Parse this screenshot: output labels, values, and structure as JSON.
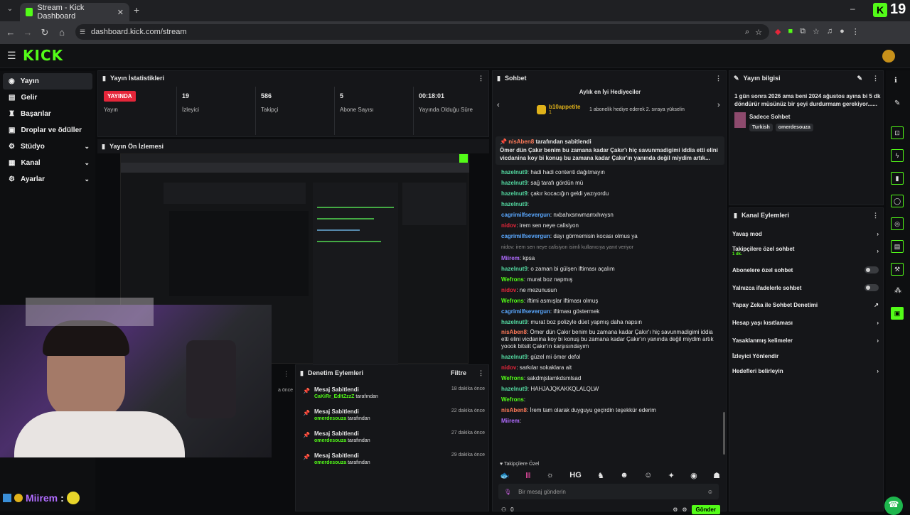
{
  "browser": {
    "tab_title": "Stream - Kick Dashboard",
    "url": "dashboard.kick.com/stream",
    "counter": "19"
  },
  "brand": {
    "logo": "KICK",
    "accent": "#53fc18"
  },
  "sidebar": {
    "items": [
      {
        "label": "Yayın"
      },
      {
        "label": "Gelir"
      },
      {
        "label": "Başarılar"
      },
      {
        "label": "Droplar ve ödüller"
      },
      {
        "label": "Stüdyo"
      },
      {
        "label": "Kanal"
      },
      {
        "label": "Ayarlar"
      }
    ]
  },
  "stats": {
    "title": "Yayın İstatistikleri",
    "live_badge": "YAYINDA",
    "live_label": "Yayın",
    "viewers_value": "19",
    "viewers_label": "İzleyici",
    "followers_value": "586",
    "followers_label": "Takipçi",
    "subs_value": "5",
    "subs_label": "Abone Sayısı",
    "duration_value": "00:18:01",
    "duration_label": "Yayında Olduğu Süre"
  },
  "preview": {
    "title": "Yayın Ön İzlemesi"
  },
  "mod_actions": {
    "title": "Denetim Eylemleri",
    "filter": "Filtre",
    "items": [
      {
        "action": "Mesaj Sabitlendi",
        "user": "CaKiRr_EdItZzzZ",
        "suffix": "tarafından",
        "time": "18 dakika önce"
      },
      {
        "action": "Mesaj Sabitlendi",
        "user": "omerdesouza",
        "suffix": "tarafından",
        "time": "22 dakika önce"
      },
      {
        "action": "Mesaj Sabitlendi",
        "user": "omerdesouza",
        "suffix": "tarafından",
        "time": "27 dakika önce"
      },
      {
        "action": "Mesaj Sabitlendi",
        "user": "omerdesouza",
        "suffix": "tarafından",
        "time": "29 dakika önce"
      }
    ],
    "peek_time": "a önce"
  },
  "chat": {
    "title": "Sohbet",
    "gifters_title": "Aylık en İyi Hediyeciler",
    "top_gifter": "b10appetite",
    "top_gifter_count": "1",
    "gift_hint": "1 abonelik hediye ederek 2. sıraya yükselin",
    "pinned_by": "nisAben8",
    "pinned_suffix": "tarafından sabitlendi",
    "pinned_text": "Ömer dün Çakır benim bu zamana kadar Çakır'ı hiç savunmadigimi iddia etti elini vicdanina koy bi konuş bu zamana kadar Çakır'ın yanında değil miydim artık...",
    "messages": [
      {
        "user": "hazelnut9",
        "color": "#53d7a0",
        "text": "hadi hadi contenti dağıtmayın"
      },
      {
        "user": "hazelnut9",
        "color": "#53d7a0",
        "text": "sağ tarafı gördün mü"
      },
      {
        "user": "hazelnut9",
        "color": "#53d7a0",
        "text": "çakır kocacığın geldi yazıyordu"
      },
      {
        "user": "hazelnut9",
        "color": "#53d7a0",
        "text": ""
      },
      {
        "user": "cagrimilfsevergun",
        "color": "#5aa8ff",
        "text": "nxbahxsnwmamxhwysn"
      },
      {
        "user": "nidov",
        "color": "#e5263a",
        "text": "irem sen neye calisiyon"
      },
      {
        "user": "cagrimilfsevergun",
        "color": "#5aa8ff",
        "text": "dayı görmemisin kocası olmus ya"
      },
      {
        "user": "",
        "color": "#8c8c8c",
        "text": "nidov: irem sen neye calisiyon isimli kullanıcıya yanıt veriyor"
      },
      {
        "user": "Miirem",
        "color": "#b06cff",
        "text": "kpsa"
      },
      {
        "user": "hazelnut9",
        "color": "#53d7a0",
        "text": "o zaman bi gülşen iftiması açalım"
      },
      {
        "user": "Wefrons",
        "color": "#53fc18",
        "text": "murat boz napmış"
      },
      {
        "user": "nidov",
        "color": "#e5263a",
        "text": "ne mezunusun"
      },
      {
        "user": "Wefrons",
        "color": "#53fc18",
        "text": "iftimi asmışlar iftiması olmuş"
      },
      {
        "user": "cagrimilfsevergun",
        "color": "#5aa8ff",
        "text": "iftiması göstermek"
      },
      {
        "user": "hazelnut9",
        "color": "#53d7a0",
        "text": "murat boz polizyle düet yapmış daha napsın"
      },
      {
        "user": "nisAben8",
        "color": "#ff7a59",
        "text": "Ömer dün Çakır benim bu zamana kadar Çakır'ı hiç savunmadigimi iddia etti elini vicdanina koy bi konuş bu zamana kadar Çakır'ın yanında değil miydim artık yoook bitsiit Çakır'ın karşısındayım"
      },
      {
        "user": "hazelnut9",
        "color": "#53d7a0",
        "text": "güzel mi ömer defol"
      },
      {
        "user": "nidov",
        "color": "#e5263a",
        "text": "sarkılar sokaklara ait"
      },
      {
        "user": "Wefrons",
        "color": "#53fc18",
        "text": "sakdmjslamkdsmlsad"
      },
      {
        "user": "hazelnut9",
        "color": "#53d7a0",
        "text": "HAHJAJQKAKKQLALQLW"
      },
      {
        "user": "Wefrons",
        "color": "#53fc18",
        "text": ""
      },
      {
        "user": "nisAben8",
        "color": "#ff7a59",
        "text": "İrem tam olarak duyguyu geçirdin teşekkür ederim"
      },
      {
        "user": "Miirem",
        "color": "#b06cff",
        "text": ""
      }
    ],
    "followers_only": "Takipçilere Özel",
    "emote_hg": "HG",
    "input_placeholder": "Bir mesaj gönderin",
    "send": "Gönder",
    "viewer_count": "0",
    "overlay_user": "Miirem"
  },
  "stream_info": {
    "title": "Yayın bilgisi",
    "text": "1 gün sonra 2026 ama beni 2024 ağustos ayına bi 5 dk döndürür müsünüz bir şeyi durdurmam gerekiyor......",
    "category": "Sadece Sohbet",
    "tags": [
      "Turkish",
      "omerdesouza"
    ]
  },
  "channel_actions": {
    "title": "Kanal Eylemleri",
    "items": [
      {
        "label": "Yavaş mod",
        "right": "chevron"
      },
      {
        "label": "Takipçilere özel sohbet",
        "sub": "1 dk.",
        "right": "chevron"
      },
      {
        "label": "Abonelere özel sohbet",
        "right": "toggle"
      },
      {
        "label": "Yalnızca ifadelerle sohbet",
        "right": "toggle"
      },
      {
        "label": "Yapay Zeka ile Sohbet Denetimi",
        "right": "external"
      },
      {
        "label": "Hesap yaşı kısıtlaması",
        "right": "chevron"
      },
      {
        "label": "Yasaklanmış kelimeler",
        "right": "chevron"
      },
      {
        "label": "İzleyici Yönlendir",
        "right": ""
      },
      {
        "label": "Hedefleri belirleyin",
        "right": "chevron"
      }
    ]
  }
}
